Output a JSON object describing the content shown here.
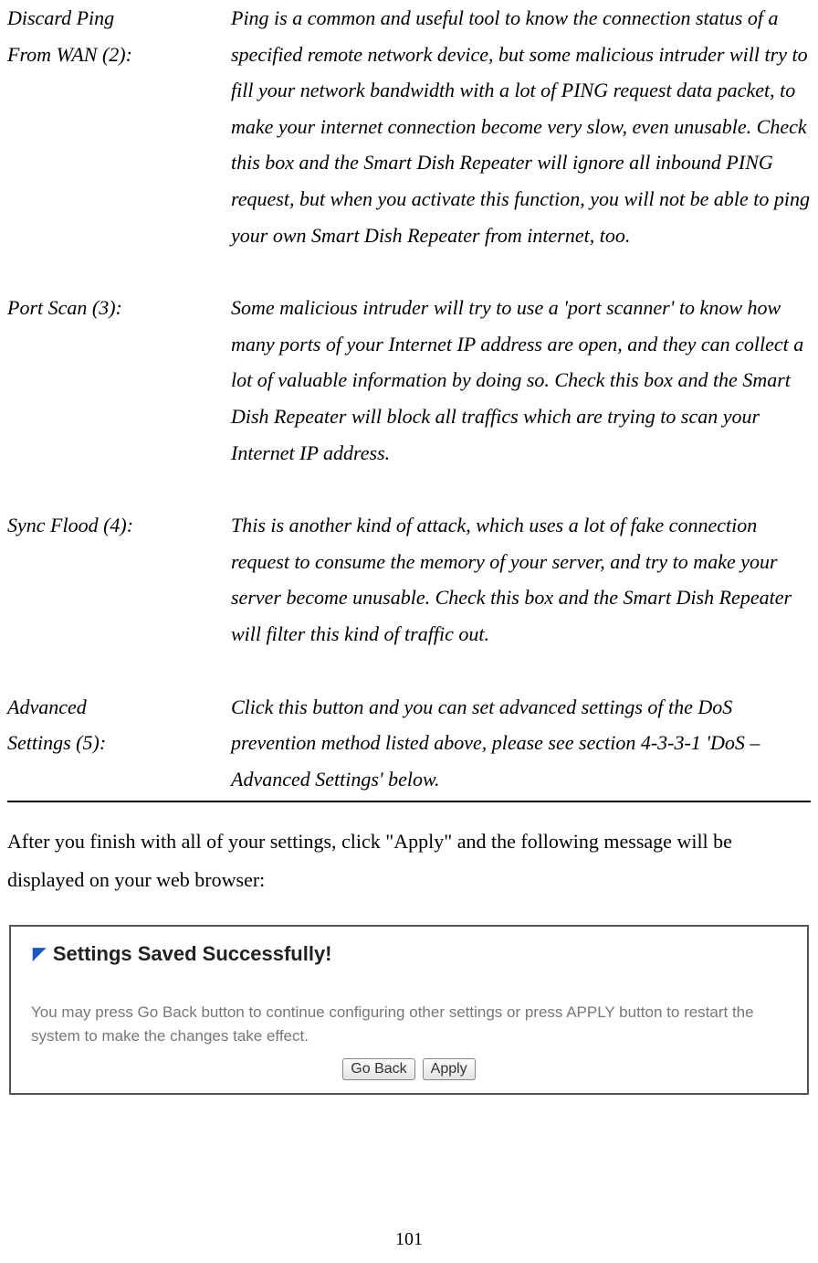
{
  "definitions": [
    {
      "label_line1": "Discard Ping",
      "label_line2": "From WAN (2):",
      "desc_line1": "Ping is a common and useful tool to know",
      "desc_rest": "the connection status of a specified remote network device, but some malicious intruder will try to fill your network bandwidth with a lot of PING request data packet, to make your internet connection become very slow, even unusable. Check this box and the Smart Dish Repeater will ignore all inbound PING request, but when you activate this function, you will not be able to ping your own Smart Dish Repeater from internet, too."
    },
    {
      "label_line1": "Port Scan (3):",
      "label_line2": "",
      "desc_line1": "",
      "desc_rest": "Some malicious intruder will try to use a 'port scanner' to know how many ports of your Internet IP address are open, and they can collect a lot of valuable information by doing so. Check this box and the Smart Dish Repeater will block all traffics which are trying to scan your Internet IP address."
    },
    {
      "label_line1": "Sync Flood (4):",
      "label_line2": "",
      "desc_line1": "",
      "desc_rest": "This is another kind of attack, which uses a lot of fake connection request to consume the memory of your server, and try to make your server become unusable. Check this box and the Smart Dish Repeater will filter this kind of traffic out."
    },
    {
      "label_line1": "Advanced",
      "label_line2": "Settings (5):",
      "desc_line1": "Click this button and you can set advanced",
      "desc_rest": "settings of the DoS prevention method listed above, please see section 4-3-3-1 'DoS – Advanced Settings' below."
    }
  ],
  "body_text": "After you finish with all of your settings, click \"Apply\" and the following message will be displayed on your web browser:",
  "dialog": {
    "title": "Settings Saved Successfully!",
    "body": "You may press Go Back button to continue configuring other settings or press APPLY button to restart the system to make the changes take effect.",
    "go_back": "Go Back",
    "apply": "Apply"
  },
  "page_number": "101"
}
